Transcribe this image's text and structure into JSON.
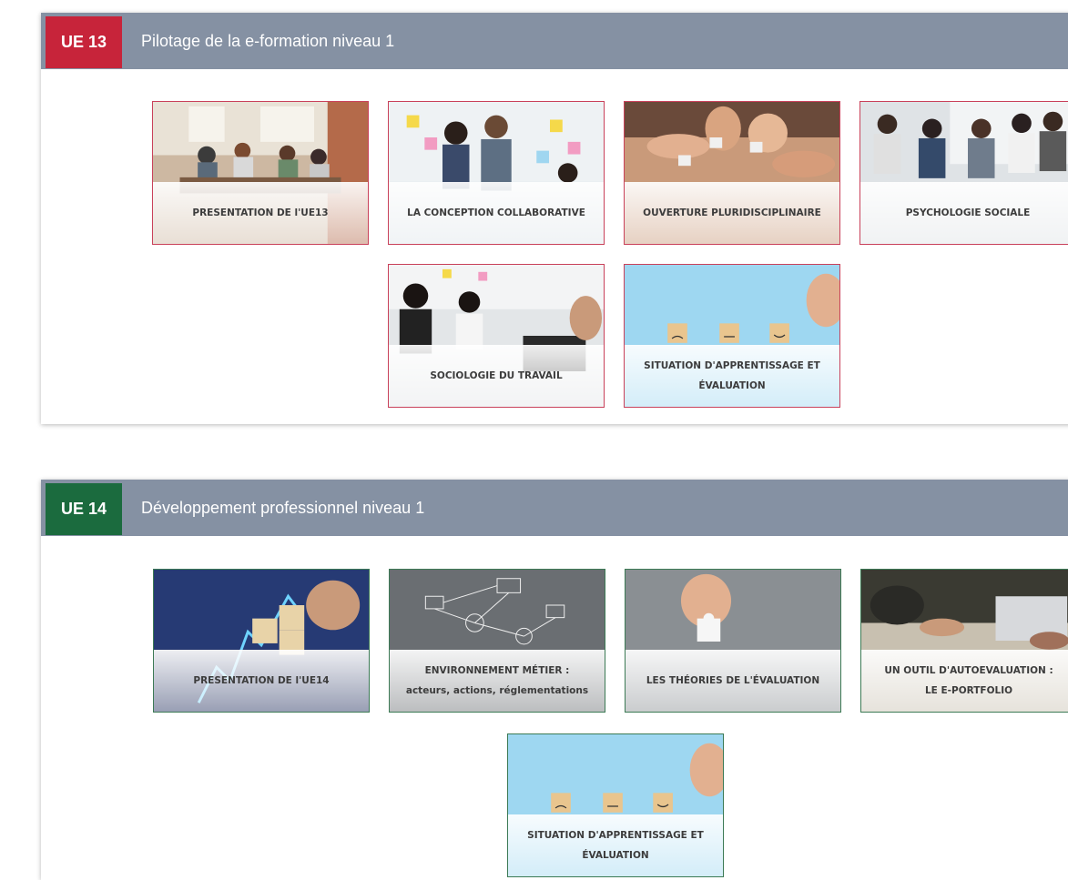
{
  "modules": [
    {
      "badge": "UE 13",
      "title": "Pilotage de la e-formation niveau 1",
      "cards": [
        {
          "lines": [
            "PRESENTATION DE l'UE13"
          ]
        },
        {
          "lines": [
            "LA CONCEPTION COLLABORATIVE"
          ]
        },
        {
          "lines": [
            "OUVERTURE PLURIDISCIPLINAIRE"
          ]
        },
        {
          "lines": [
            "PSYCHOLOGIE SOCIALE"
          ]
        },
        {
          "lines": [
            "SOCIOLOGIE DU TRAVAIL"
          ]
        },
        {
          "lines": [
            "SITUATION D'APPRENTISSAGE ET",
            "ÉVALUATION"
          ]
        }
      ]
    },
    {
      "badge": "UE 14",
      "title": "Développement professionnel niveau 1",
      "cards": [
        {
          "lines": [
            "PRESENTATION DE l'UE14"
          ]
        },
        {
          "lines": [
            "ENVIRONNEMENT MÉTIER :",
            "acteurs, actions, réglementations"
          ]
        },
        {
          "lines": [
            "LES THÉORIES DE L'ÉVALUATION"
          ]
        },
        {
          "lines": [
            "UN OUTIL D'AUTOEVALUATION :",
            "LE E-PORTFOLIO"
          ]
        },
        {
          "lines": [
            "SITUATION D'APPRENTISSAGE ET",
            "ÉVALUATION"
          ]
        }
      ]
    }
  ],
  "colors": {
    "header_bg": "#8591a3",
    "ue13_accent": "#c7243a",
    "ue14_accent": "#1b6b3e"
  }
}
